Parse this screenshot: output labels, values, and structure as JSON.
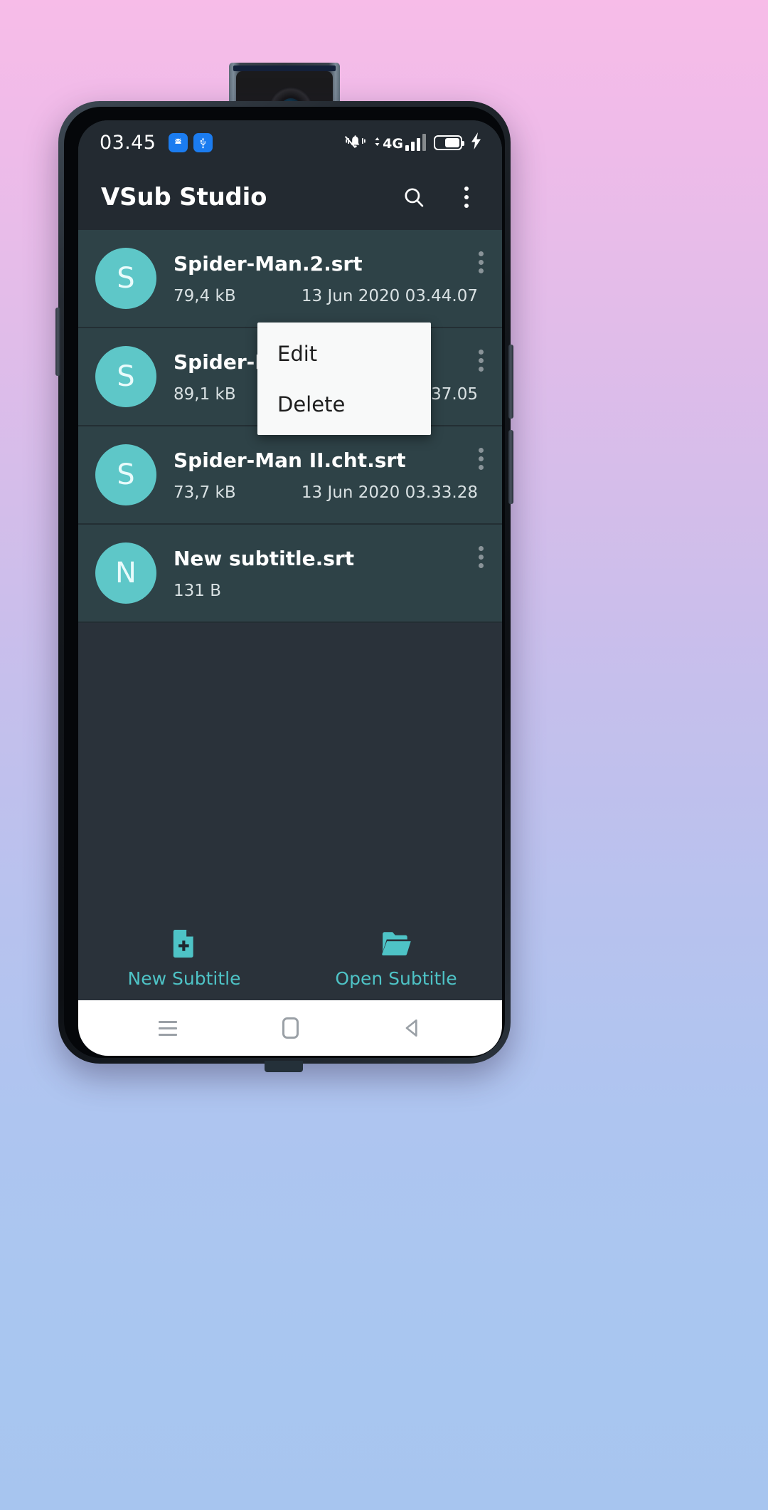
{
  "wallpaper": {
    "gradient_top": "#f7bce8",
    "gradient_bottom": "#a7c5ef"
  },
  "device": {
    "name": "pop-up-camera-phone",
    "frame_color": "#14181d"
  },
  "status_bar": {
    "time": "03.45",
    "left_icons": [
      "android-icon",
      "usb-icon"
    ],
    "right_icons": [
      "vibrate-off-icon",
      "mobile-data-4g-icon",
      "signal-bars-icon",
      "battery-charging-icon"
    ],
    "network_label": "4G",
    "chip_color": "#1b7cf0"
  },
  "app_bar": {
    "title": "VSub Studio",
    "search_icon": "search-icon",
    "overflow_icon": "more-vert-icon",
    "background": "#232a31"
  },
  "file_list": {
    "row_background": "#2e4247",
    "avatar_color": "#5ec7c8",
    "rows": [
      {
        "avatar_letter": "S",
        "name": "Spider-Man.2.srt",
        "size": "79,4 kB",
        "date": "13 Jun 2020 03.44.07"
      },
      {
        "avatar_letter": "S",
        "name": "Spider-Man2.AR.srt",
        "size": "89,1 kB",
        "date": "13 Jun 2020 03.37.05"
      },
      {
        "avatar_letter": "S",
        "name": "Spider-Man II.cht.srt",
        "size": "73,7 kB",
        "date": "13 Jun 2020 03.33.28"
      },
      {
        "avatar_letter": "N",
        "name": "New subtitle.srt",
        "size": "131 B",
        "date": ""
      }
    ]
  },
  "popup_menu": {
    "visible": true,
    "items": [
      {
        "label": "Edit"
      },
      {
        "label": "Delete"
      }
    ],
    "background": "#f8f9f9"
  },
  "bottom_bar": {
    "accent_color": "#4ec3c6",
    "actions": [
      {
        "label": "New Subtitle",
        "icon": "new-file-icon"
      },
      {
        "label": "Open Subtitle",
        "icon": "open-folder-icon"
      }
    ]
  },
  "nav_bar": {
    "buttons": [
      "recents-icon",
      "home-icon",
      "back-icon"
    ],
    "background": "#ffffff"
  }
}
